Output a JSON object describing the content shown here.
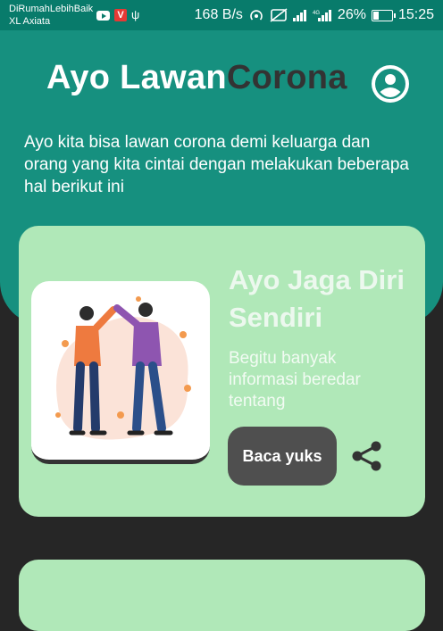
{
  "status_bar": {
    "carrier_line1": "DiRumahLebihBaik",
    "carrier_line2": "XL Axiata",
    "v_badge": "V",
    "usb_glyph": "ψ",
    "net_speed": "168 B/s",
    "battery": "26%",
    "time": "15:25"
  },
  "header": {
    "title_main": "Ayo Lawan",
    "title_accent": "Corona",
    "subtitle": "Ayo kita bisa lawan corona demi keluarga dan orang yang kita cintai dengan melakukan beberapa hal berikut ini"
  },
  "cards": [
    {
      "title": "Ayo Jaga Diri Sendiri",
      "description": "Begitu banyak informasi beredar tentang",
      "button_label": "Baca yuks",
      "illustration": "elbow-bump-illustration",
      "share_icon": "share-icon"
    }
  ],
  "colors": {
    "status_bar": "#087B6B",
    "header": "#16907F",
    "card": "#B0E8B8",
    "background": "#262626",
    "button": "#4F4F4F"
  }
}
